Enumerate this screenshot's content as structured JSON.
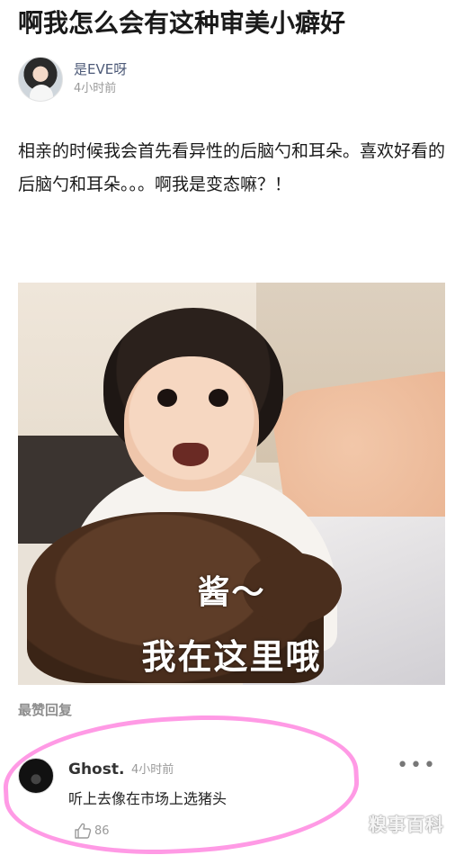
{
  "post": {
    "title": "啊我怎么会有这种审美小癖好",
    "body": "相亲的时候我会首先看异性的后脑勺和耳朵。喜欢好看的后脑勺和耳朵。。。啊我是变态嘛？！"
  },
  "author": {
    "name": "是EVE呀",
    "time": "4小时前"
  },
  "image": {
    "caption_line1": "酱～",
    "caption_line2": "我在这里哦"
  },
  "replies": {
    "section_label": "最赞回复",
    "items": [
      {
        "name": "Ghost.",
        "time": "4小时前",
        "text": "听上去像在市场上选猪头",
        "likes": "86",
        "more": "•••"
      }
    ]
  },
  "watermark": "糗事百科",
  "colors": {
    "highlight_circle": "#ff78dc",
    "author_name": "#4d5a78",
    "muted": "#9a9a9a"
  }
}
